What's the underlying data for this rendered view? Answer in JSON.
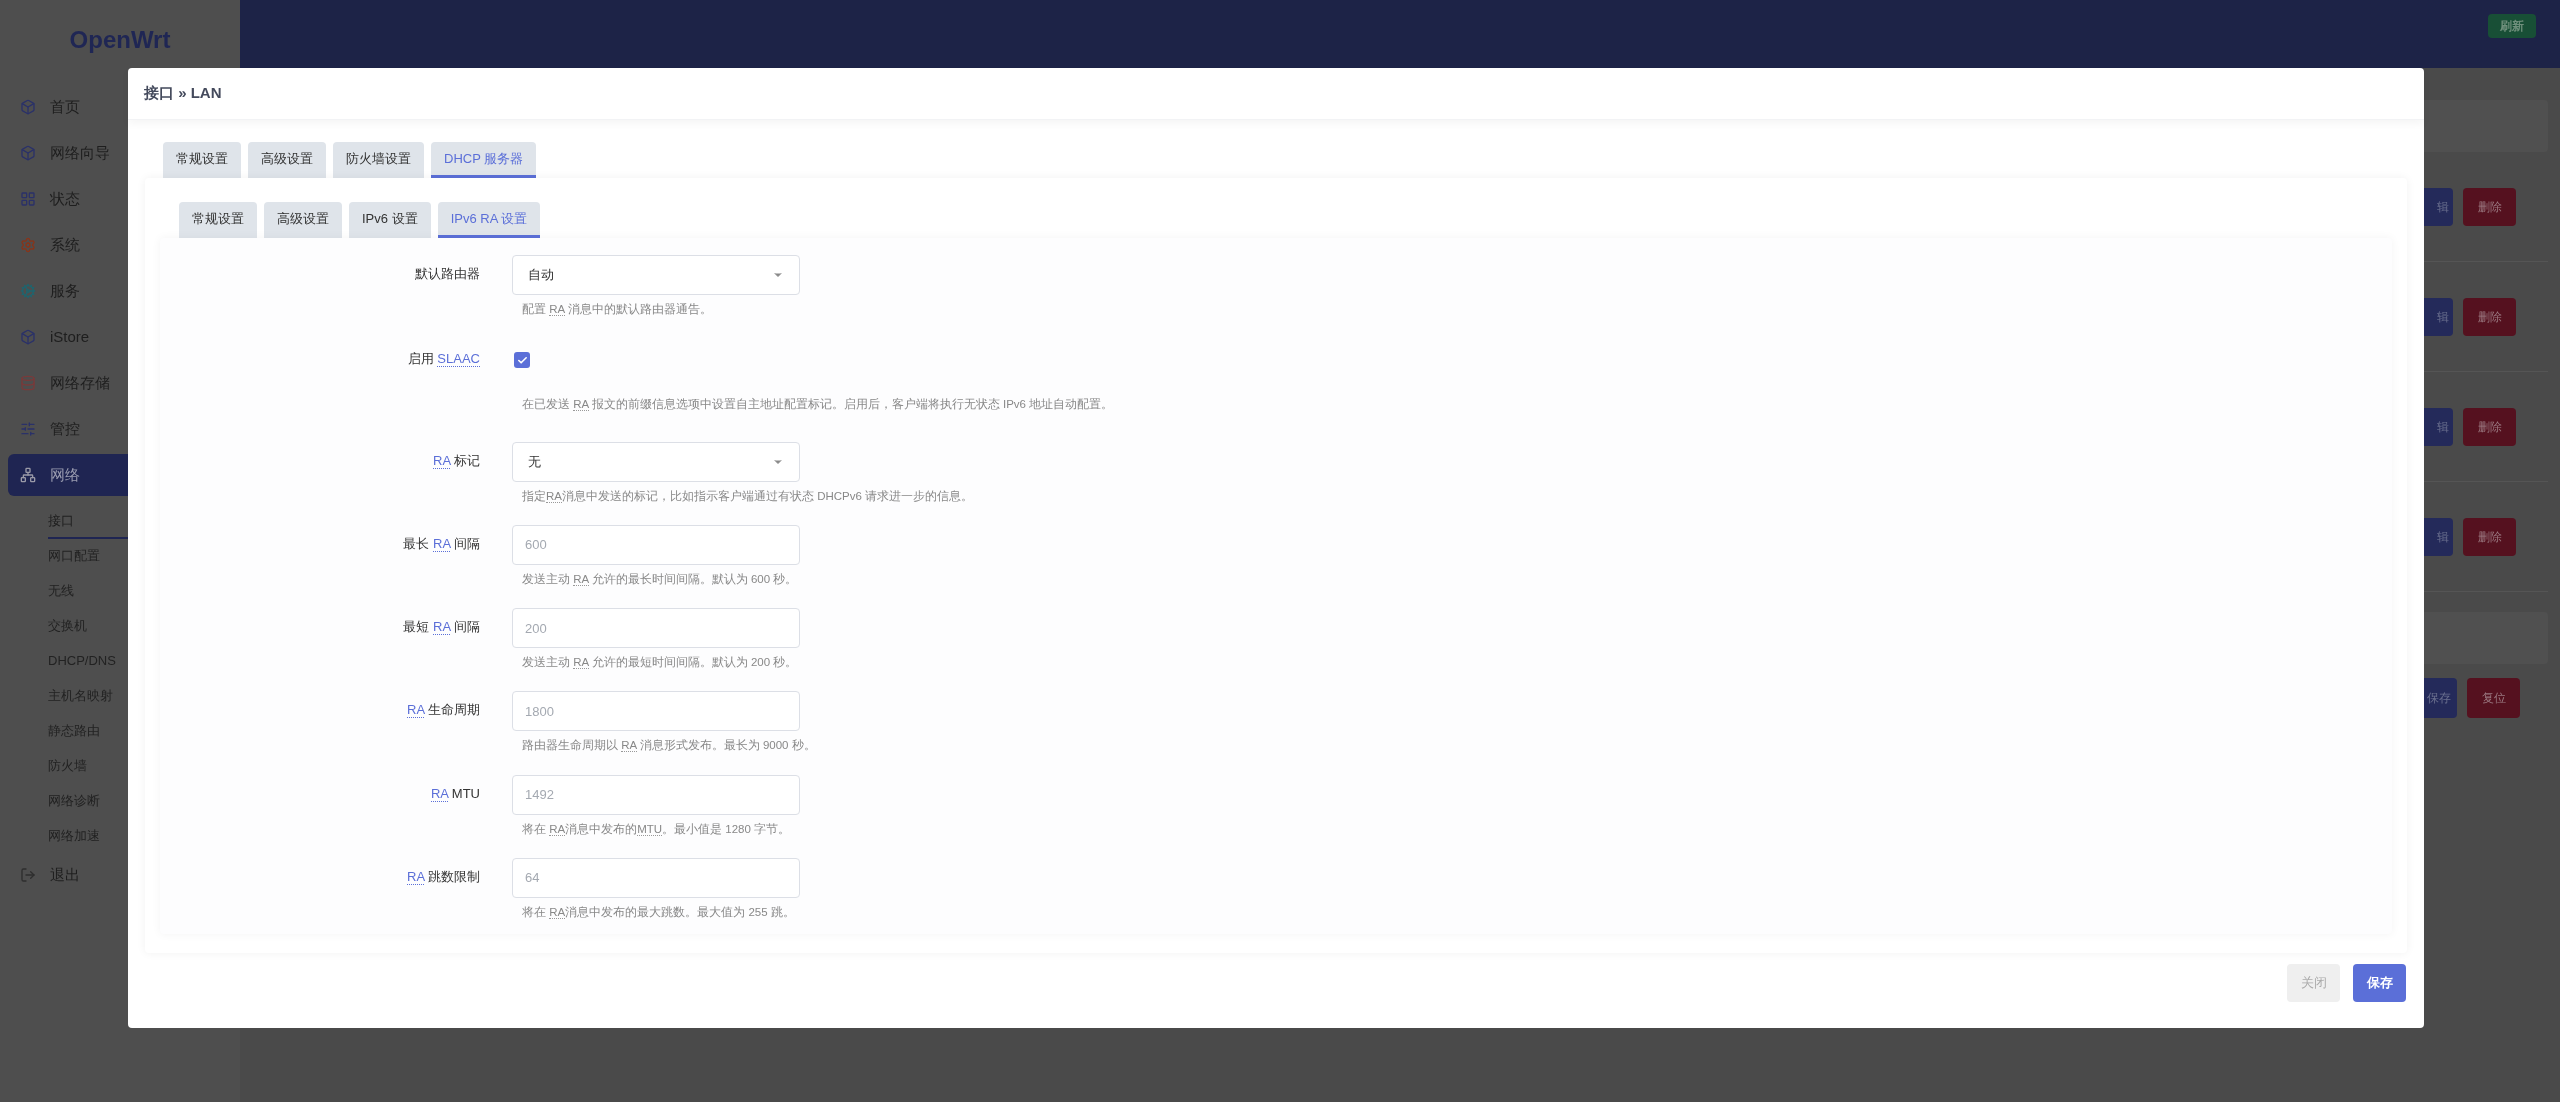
{
  "sidebar": {
    "logo": "OpenWrt",
    "items": [
      {
        "label": "首页",
        "selected": false
      },
      {
        "label": "网络向导",
        "selected": false
      },
      {
        "label": "状态",
        "selected": false
      },
      {
        "label": "系统",
        "selected": false
      },
      {
        "label": "服务",
        "selected": false
      },
      {
        "label": "iStore",
        "selected": false
      },
      {
        "label": "网络存储",
        "selected": false
      },
      {
        "label": "管控",
        "selected": false
      },
      {
        "label": "网络",
        "selected": true,
        "children": [
          {
            "label": "接口",
            "selected": true
          },
          {
            "label": "网口配置",
            "selected": false
          },
          {
            "label": "无线",
            "selected": false
          },
          {
            "label": "交换机",
            "selected": false
          },
          {
            "label": "DHCP/DNS",
            "selected": false
          },
          {
            "label": "主机名映射",
            "selected": false
          },
          {
            "label": "静态路由",
            "selected": false
          },
          {
            "label": "防火墙",
            "selected": false
          },
          {
            "label": "网络诊断",
            "selected": false
          },
          {
            "label": "网络加速",
            "selected": false
          }
        ]
      },
      {
        "label": "退出",
        "selected": false
      }
    ]
  },
  "header": {
    "refresh_button": "刷新"
  },
  "background": {
    "rows": [
      {
        "edit_button": "辑",
        "delete_button": "删除"
      },
      {
        "edit_button": "辑",
        "delete_button": "删除"
      },
      {
        "edit_button": "辑",
        "delete_button": "删除"
      },
      {
        "edit_button": "辑",
        "delete_button": "删除"
      }
    ],
    "save_button": "保存",
    "reset_button": "复位"
  },
  "modal": {
    "title": "接口 » LAN",
    "tabs": [
      {
        "label": "常规设置",
        "selected": false
      },
      {
        "label": "高级设置",
        "selected": false
      },
      {
        "label": "防火墙设置",
        "selected": false
      },
      {
        "label": "DHCP 服务器",
        "selected": true
      }
    ],
    "subtabs": [
      {
        "label": "常规设置",
        "selected": false
      },
      {
        "label": "高级设置",
        "selected": false
      },
      {
        "label": "IPv6 设置",
        "selected": false
      },
      {
        "label": "IPv6 RA 设置",
        "selected": true
      }
    ],
    "fields": [
      {
        "kind": "select",
        "label": [
          {
            "text": "默认路由器"
          }
        ],
        "value": "自动",
        "help": [
          {
            "text": "配置 "
          },
          {
            "text": "RA",
            "abbr": true
          },
          {
            "text": " 消息中的默认路由器通告。"
          }
        ]
      },
      {
        "kind": "checkbox",
        "label": [
          {
            "text": "启用 "
          },
          {
            "text": "SLAAC",
            "abbr": true
          }
        ],
        "checked": true,
        "help": [
          {
            "text": "在已发送 "
          },
          {
            "text": "RA",
            "abbr": true
          },
          {
            "text": " 报文的前缀信息选项中设置自主地址配置标记。启用后，客户端将执行无状态 IPv6 地址自动配置。"
          }
        ]
      },
      {
        "kind": "select",
        "label": [
          {
            "text": "RA",
            "abbr": true
          },
          {
            "text": " 标记"
          }
        ],
        "value": "无",
        "help": [
          {
            "text": "指定"
          },
          {
            "text": "RA",
            "abbr": true
          },
          {
            "text": "消息中发送的标记，比如指示客户端通过有状态 DHCPv6 请求进一步的信息。"
          }
        ]
      },
      {
        "kind": "input",
        "label": [
          {
            "text": "最长 "
          },
          {
            "text": "RA",
            "abbr": true
          },
          {
            "text": " 间隔"
          }
        ],
        "placeholder": "600",
        "help": [
          {
            "text": "发送主动 "
          },
          {
            "text": "RA",
            "abbr": true
          },
          {
            "text": " 允许的最长时间间隔。默认为 600 秒。"
          }
        ]
      },
      {
        "kind": "input",
        "label": [
          {
            "text": "最短 "
          },
          {
            "text": "RA",
            "abbr": true
          },
          {
            "text": " 间隔"
          }
        ],
        "placeholder": "200",
        "help": [
          {
            "text": "发送主动 "
          },
          {
            "text": "RA",
            "abbr": true
          },
          {
            "text": " 允许的最短时间间隔。默认为 200 秒。"
          }
        ]
      },
      {
        "kind": "input",
        "label": [
          {
            "text": "RA",
            "abbr": true
          },
          {
            "text": " 生命周期"
          }
        ],
        "placeholder": "1800",
        "help": [
          {
            "text": "路由器生命周期以 "
          },
          {
            "text": "RA",
            "abbr": true
          },
          {
            "text": " 消息形式发布。最长为 9000 秒。"
          }
        ]
      },
      {
        "kind": "input",
        "label": [
          {
            "text": "RA",
            "abbr": true
          },
          {
            "text": " MTU"
          }
        ],
        "placeholder": "1492",
        "help": [
          {
            "text": "将在 "
          },
          {
            "text": "RA",
            "abbr": true
          },
          {
            "text": "消息中发布的"
          },
          {
            "text": "MTU",
            "abbr": true
          },
          {
            "text": "。最小值是 1280 字节。"
          }
        ]
      },
      {
        "kind": "input",
        "label": [
          {
            "text": "RA",
            "abbr": true
          },
          {
            "text": " 跳数限制"
          }
        ],
        "placeholder": "64",
        "help": [
          {
            "text": "将在 "
          },
          {
            "text": "RA",
            "abbr": true
          },
          {
            "text": "消息中发布的最大跳数。最大值为 255 跳。"
          }
        ]
      }
    ],
    "buttons": [
      {
        "label": "关闭",
        "kind": "secondary"
      },
      {
        "label": "保存",
        "kind": "primary"
      }
    ]
  }
}
